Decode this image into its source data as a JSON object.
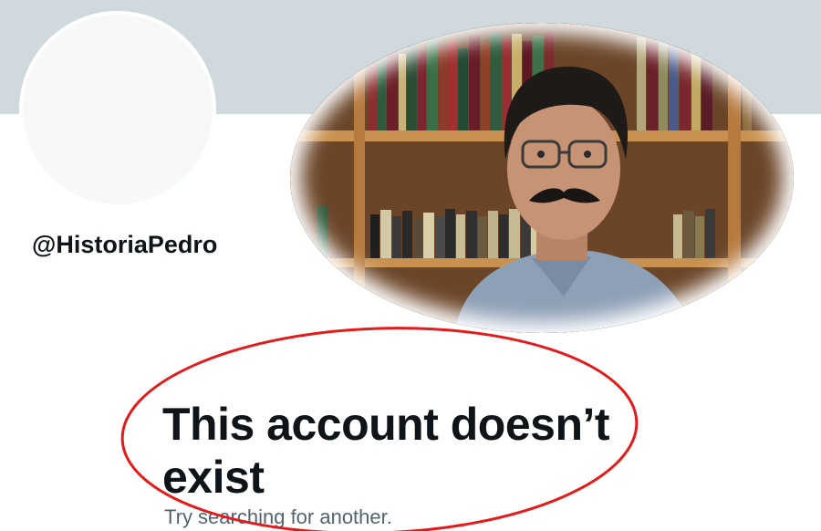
{
  "profile": {
    "handle": "@HistoriaPedro"
  },
  "message": {
    "title": "This account doesn’t exist",
    "subtitle": "Try searching for another."
  },
  "colors": {
    "banner": "#cfd9de",
    "annotation": "#e31b1b",
    "text_primary": "#0f1419",
    "text_secondary": "#536471"
  }
}
